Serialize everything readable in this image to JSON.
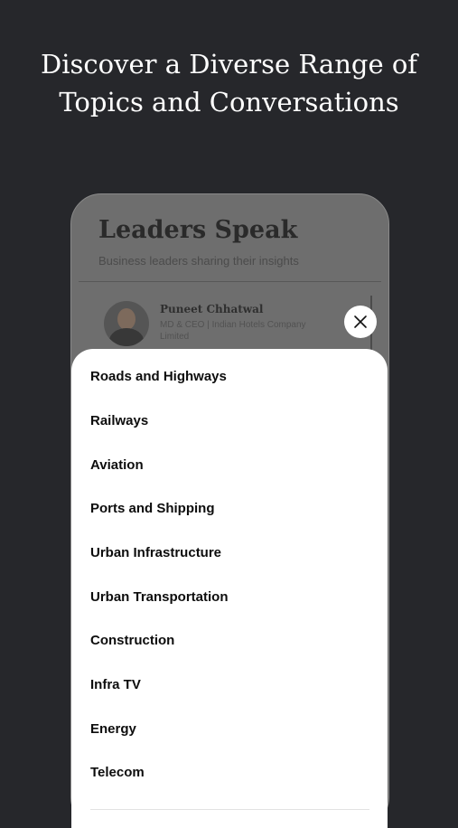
{
  "headline": {
    "line1": "Discover a Diverse Range of",
    "line2": "Topics and Conversations"
  },
  "screen": {
    "title": "Leaders Speak",
    "subtitle": "Business leaders sharing their insights",
    "leader": {
      "name": "Puneet Chhatwal",
      "role": "MD & CEO | Indian Hotels Company Limited"
    }
  },
  "topics": [
    "Roads and Highways",
    "Railways",
    "Aviation",
    "Ports and Shipping",
    "Urban Infrastructure",
    "Urban Transportation",
    "Construction",
    "Infra TV",
    "Energy",
    "Telecom"
  ],
  "icons": {
    "close": "close-icon"
  },
  "colors": {
    "background": "#26272b",
    "sheet": "#ffffff",
    "text": "#0d0d0d"
  }
}
